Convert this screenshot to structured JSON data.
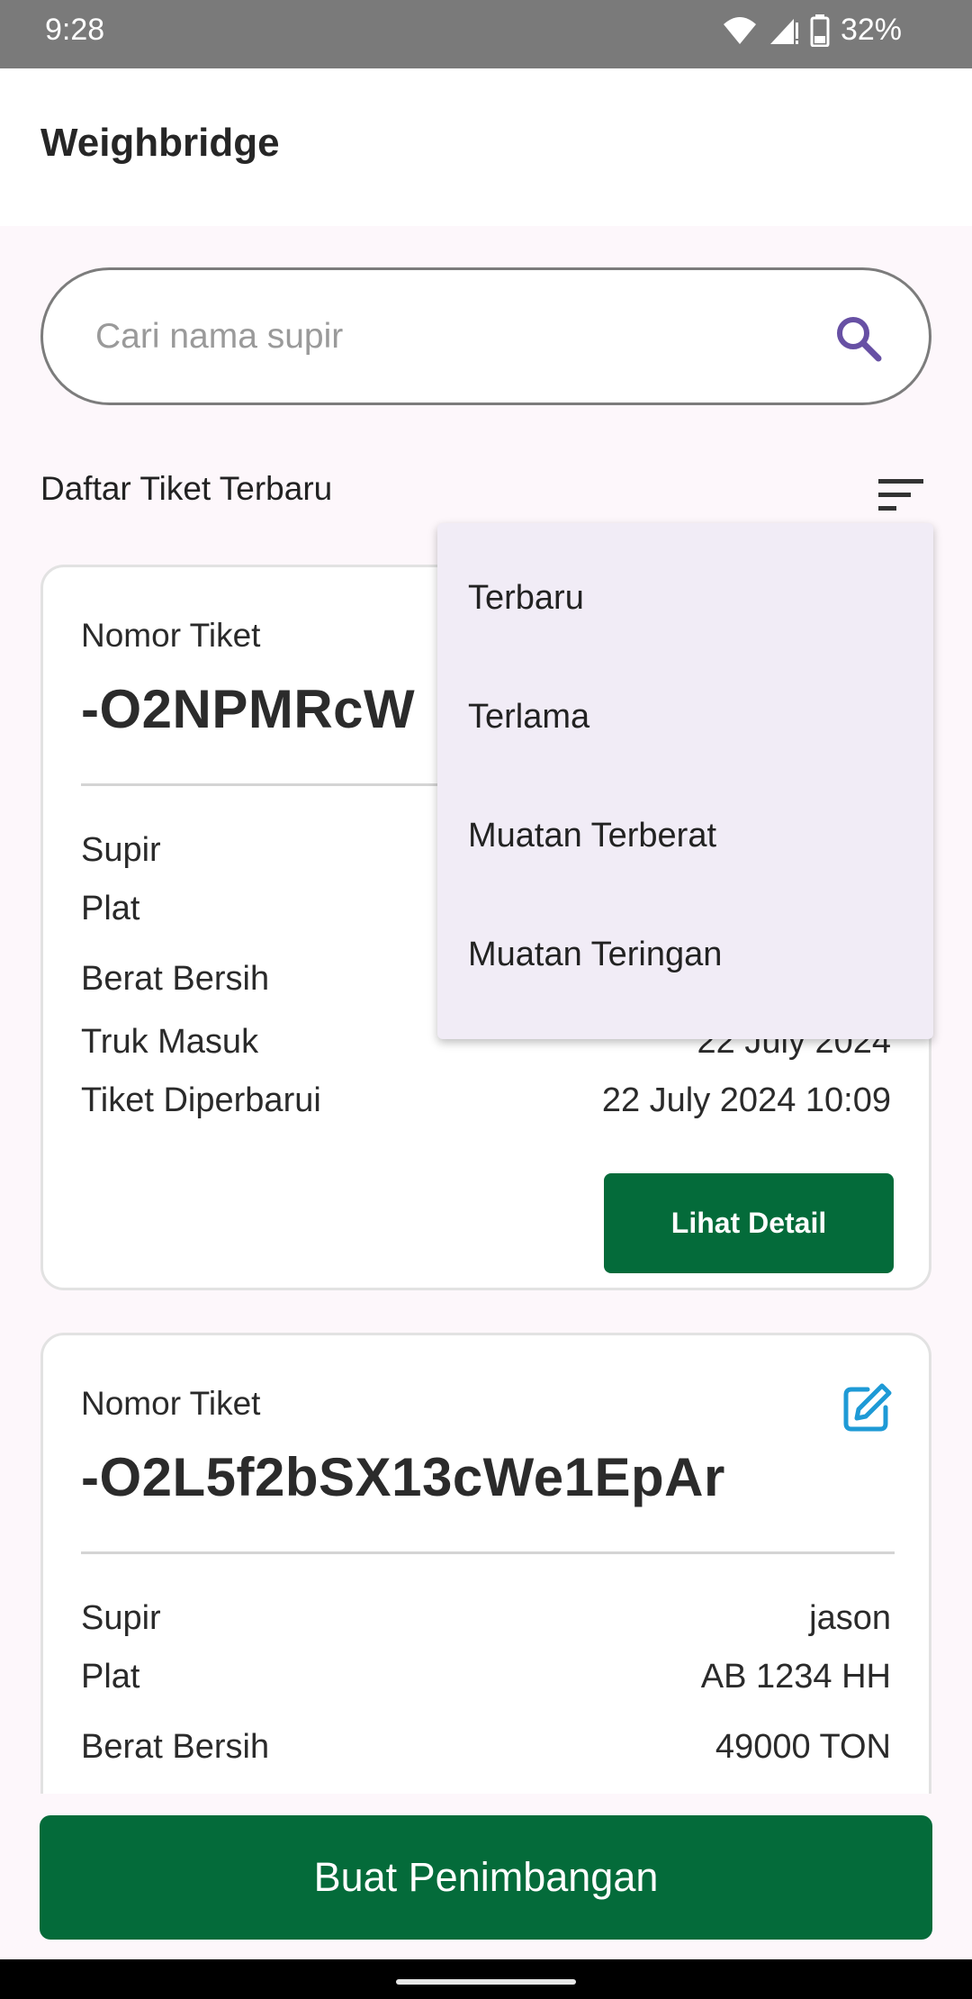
{
  "status_bar": {
    "time": "9:28",
    "battery": "32%"
  },
  "app_bar": {
    "title": "Weighbridge"
  },
  "search": {
    "placeholder": "Cari nama supir",
    "value": ""
  },
  "list": {
    "title": "Daftar Tiket Terbaru"
  },
  "sort_menu": {
    "options": [
      "Terbaru",
      "Terlama",
      "Muatan Terberat",
      "Muatan Teringan"
    ]
  },
  "tickets": [
    {
      "label": "Nomor Tiket",
      "number": "-O2NPMRcW",
      "driver_label": "Supir",
      "plate_label": "Plat",
      "net_weight_label": "Berat Bersih",
      "truck_in_label": "Truk Masuk",
      "truck_in_value": "22 July 2024",
      "updated_label": "Tiket Diperbarui",
      "updated_value": "22 July 2024 10:09",
      "detail_button": "Lihat Detail"
    },
    {
      "label": "Nomor Tiket",
      "number": "-O2L5f2bSX13cWe1EpAr",
      "driver_label": "Supir",
      "driver_value": "jason",
      "plate_label": "Plat",
      "plate_value": "AB 1234 HH",
      "net_weight_label": "Berat Bersih",
      "net_weight_value": "49000 TON"
    }
  ],
  "actions": {
    "create_button": "Buat Penimbangan"
  },
  "colors": {
    "primary": "#046b3a",
    "search_icon": "#6750a4",
    "edit_icon": "#1e9ad6",
    "menu_bg": "#f1ecf6"
  }
}
